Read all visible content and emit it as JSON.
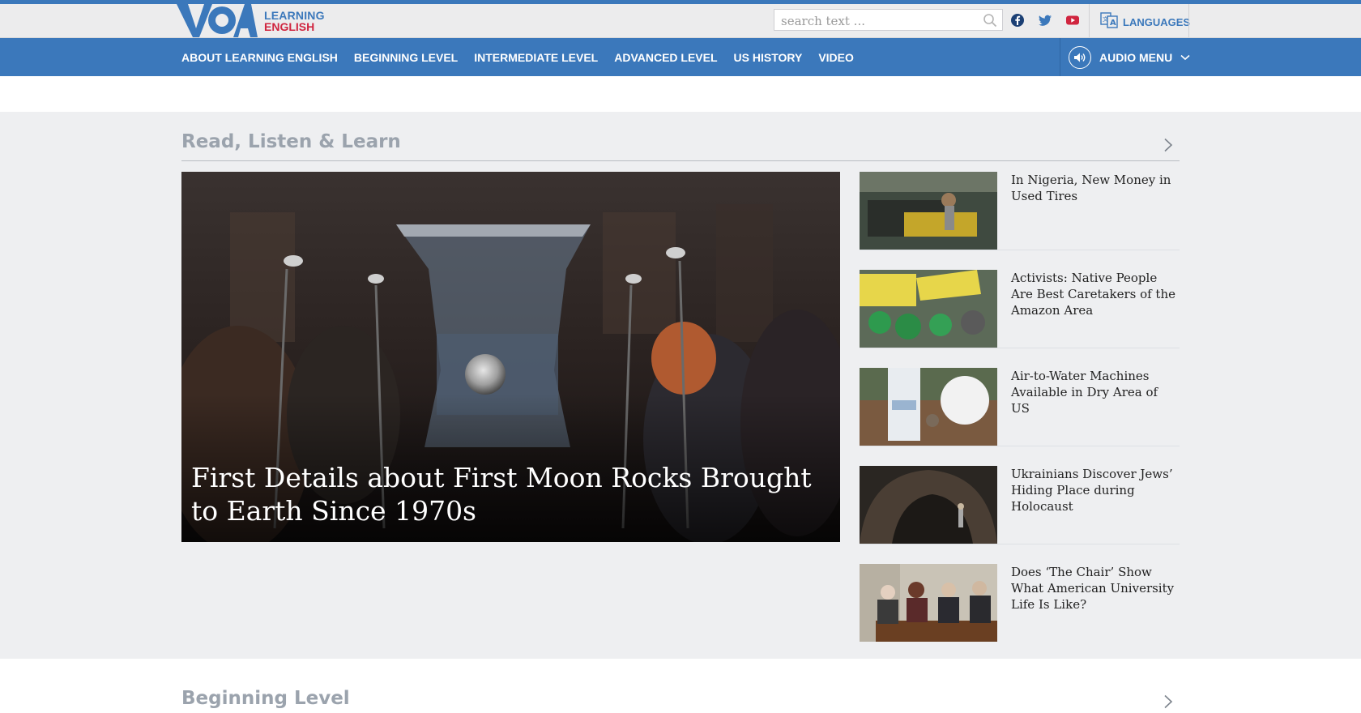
{
  "header": {
    "logo_line1": "LEARNING",
    "logo_line2": "ENGLISH",
    "search_placeholder": "search text ...",
    "social": [
      "facebook-icon",
      "twitter-icon",
      "youtube-icon"
    ],
    "languages_label": "LANGUAGES"
  },
  "nav": {
    "items": [
      {
        "label": "ABOUT LEARNING ENGLISH"
      },
      {
        "label": "BEGINNING LEVEL"
      },
      {
        "label": "INTERMEDIATE LEVEL"
      },
      {
        "label": "ADVANCED LEVEL"
      },
      {
        "label": "US HISTORY"
      },
      {
        "label": "VIDEO"
      }
    ],
    "audio_menu_label": "AUDIO MENU"
  },
  "section": {
    "title": "Read, Listen & Learn",
    "hero_title": "First Details about First Moon Rocks Brought to Earth Since 1970s",
    "side_items": [
      {
        "title": "In Nigeria, New Money in Used Tires"
      },
      {
        "title": "Activists: Native People Are Best Caretakers of the Amazon Area"
      },
      {
        "title": "Air-to-Water Machines Available in Dry Area of US"
      },
      {
        "title": "Ukrainians Discover Jews’ Hiding Place during Holocaust"
      },
      {
        "title": "Does ‘The Chair’ Show What American University Life Is Like?"
      }
    ]
  },
  "next_section": {
    "title": "Beginning Level"
  },
  "colors": {
    "brand_blue": "#3b78bb",
    "brand_red": "#d0253f",
    "section_bg": "#eeeff1"
  }
}
